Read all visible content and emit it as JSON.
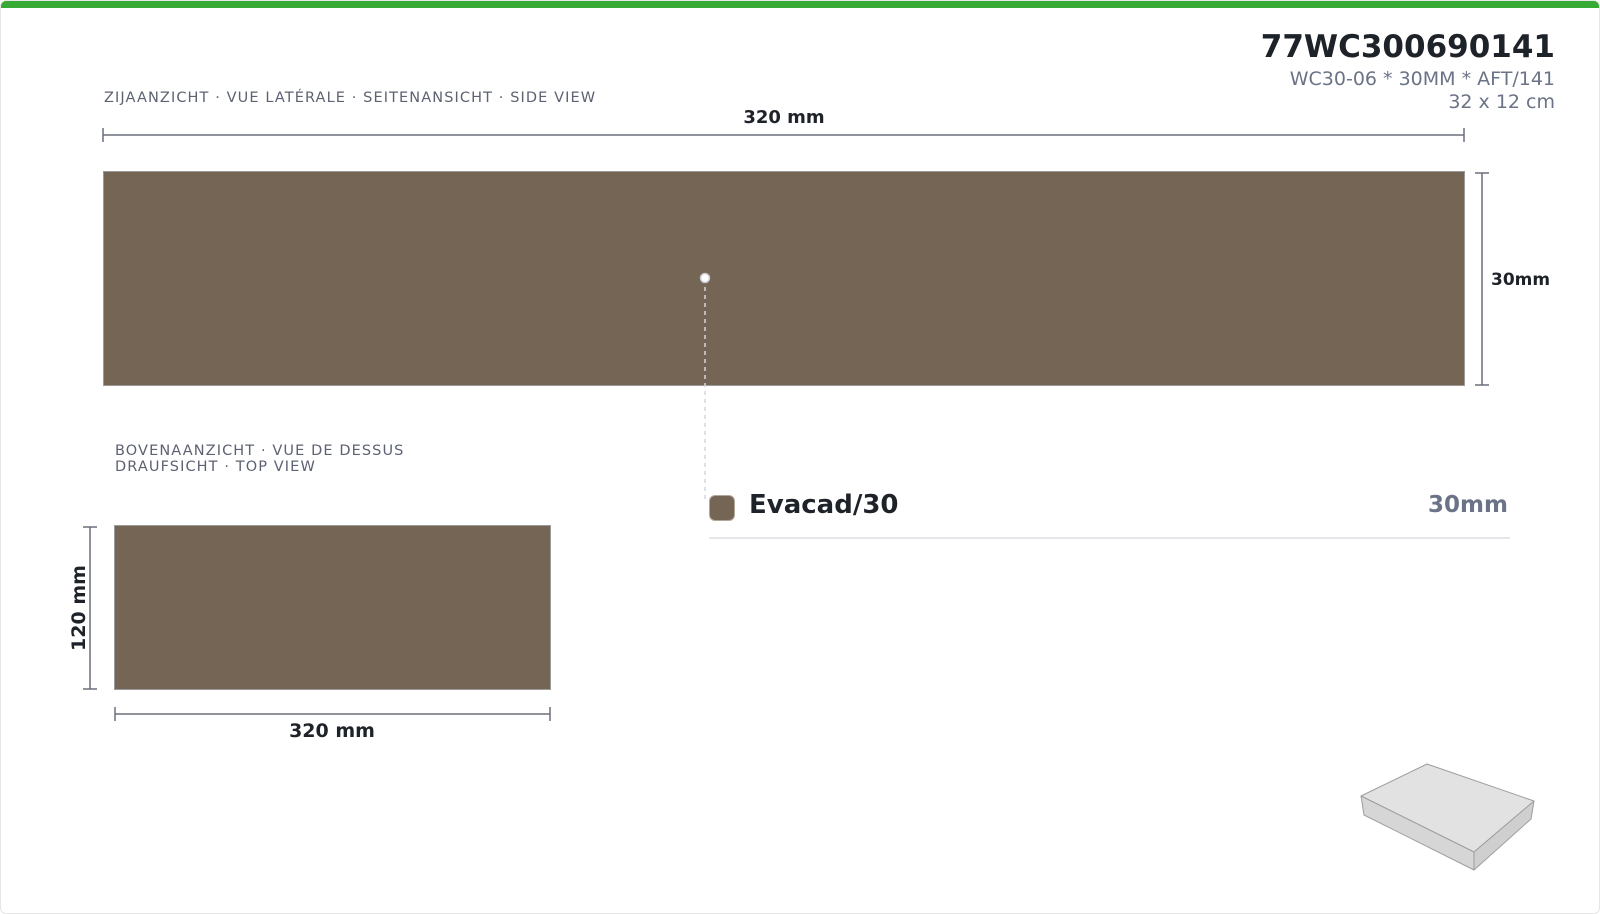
{
  "header": {
    "code": "77WC300690141",
    "description": "WC30-06 * 30MM * AFT/141",
    "size": "32 x 12 cm"
  },
  "side_view": {
    "caption": "ZIJAANZICHT · VUE LATÉRALE · SEITENANSICHT · SIDE VIEW",
    "width_label": "320 mm",
    "height_label": "30mm"
  },
  "top_view": {
    "caption_line1": "BOVENAANZICHT · VUE DE DESSUS",
    "caption_line2": "DRAUFSICHT · TOP VIEW",
    "width_label": "320 mm",
    "depth_label": "120 mm"
  },
  "legend": {
    "material": "Evacad/30",
    "thickness": "30mm"
  },
  "colors": {
    "accent_bar": "#37a935",
    "material": "#756555",
    "dimension_line": "#6b6f7c",
    "text_dark": "#1e2229",
    "text_muted": "#6b7386"
  },
  "icons": {
    "preview": "3d-slab-icon"
  }
}
